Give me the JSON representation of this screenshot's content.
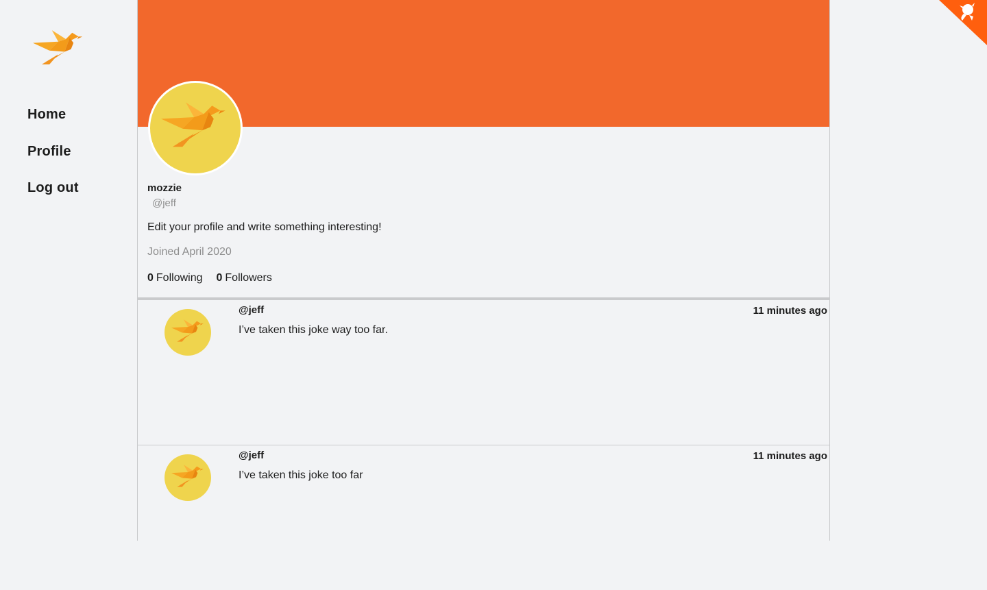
{
  "app": {
    "logo_icon": "bird-logo-icon",
    "accent_color": "#f2682c",
    "avatar_color": "#efd44d"
  },
  "nav": {
    "items": [
      {
        "label": "Home"
      },
      {
        "label": "Profile"
      },
      {
        "label": "Log out"
      }
    ]
  },
  "profile": {
    "display_name": "mozzie",
    "handle": "@jeff",
    "bio": "Edit your profile and write something interesting!",
    "joined": "Joined April 2020",
    "following_count": "0",
    "following_label": "Following",
    "followers_count": "0",
    "followers_label": "Followers"
  },
  "tweets": [
    {
      "handle": "@jeff",
      "time": "11 minutes ago",
      "text": "I’ve taken this joke way too far."
    },
    {
      "handle": "@jeff",
      "time": "11 minutes ago",
      "text": "I’ve taken this joke too far"
    }
  ],
  "corner_badge": {
    "icon": "github-octocat-icon"
  }
}
